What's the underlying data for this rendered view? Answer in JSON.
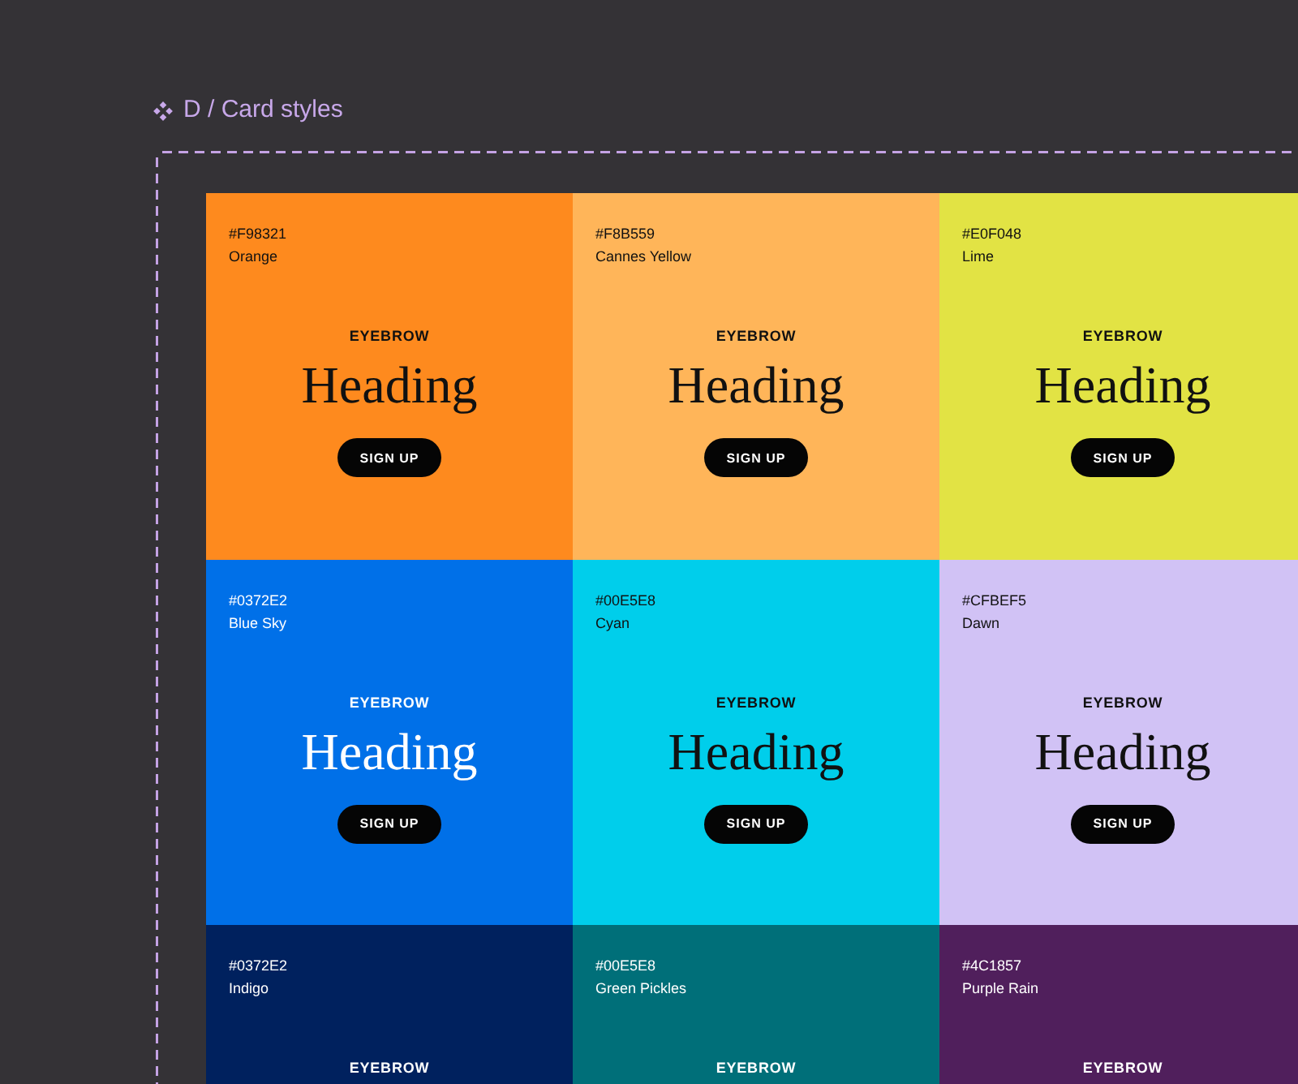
{
  "title": "D / Card styles",
  "cards": [
    {
      "hex": "#F98321",
      "name": "Orange",
      "color": "#fe8a1e",
      "light_text": false,
      "eyebrow": "EYEBROW",
      "heading": "Heading",
      "button": "SIGN UP"
    },
    {
      "hex": "#F8B559",
      "name": "Cannes Yellow",
      "color": "#ffb559",
      "light_text": false,
      "eyebrow": "EYEBROW",
      "heading": "Heading",
      "button": "SIGN UP"
    },
    {
      "hex": "#E0F048",
      "name": "Lime",
      "color": "#e2e344",
      "light_text": false,
      "eyebrow": "EYEBROW",
      "heading": "Heading",
      "button": "SIGN UP"
    },
    {
      "hex": "#0372E2",
      "name": "Blue Sky",
      "color": "#0070e8",
      "light_text": true,
      "eyebrow": "EYEBROW",
      "heading": "Heading",
      "button": "SIGN UP"
    },
    {
      "hex": "#00E5E8",
      "name": "Cyan",
      "color": "#00ceeb",
      "light_text": false,
      "eyebrow": "EYEBROW",
      "heading": "Heading",
      "button": "SIGN UP"
    },
    {
      "hex": "#CFBEF5",
      "name": "Dawn",
      "color": "#d1c2f5",
      "light_text": false,
      "eyebrow": "EYEBROW",
      "heading": "Heading",
      "button": "SIGN UP"
    },
    {
      "hex": "#0372E2",
      "name": "Indigo",
      "color": "#00215e",
      "light_text": true,
      "eyebrow": "EYEBROW"
    },
    {
      "hex": "#00E5E8",
      "name": "Green Pickles",
      "color": "#006f79",
      "light_text": true,
      "eyebrow": "EYEBROW"
    },
    {
      "hex": "#4C1857",
      "name": "Purple Rain",
      "color": "#501f5c",
      "light_text": true,
      "eyebrow": "EYEBROW"
    }
  ]
}
